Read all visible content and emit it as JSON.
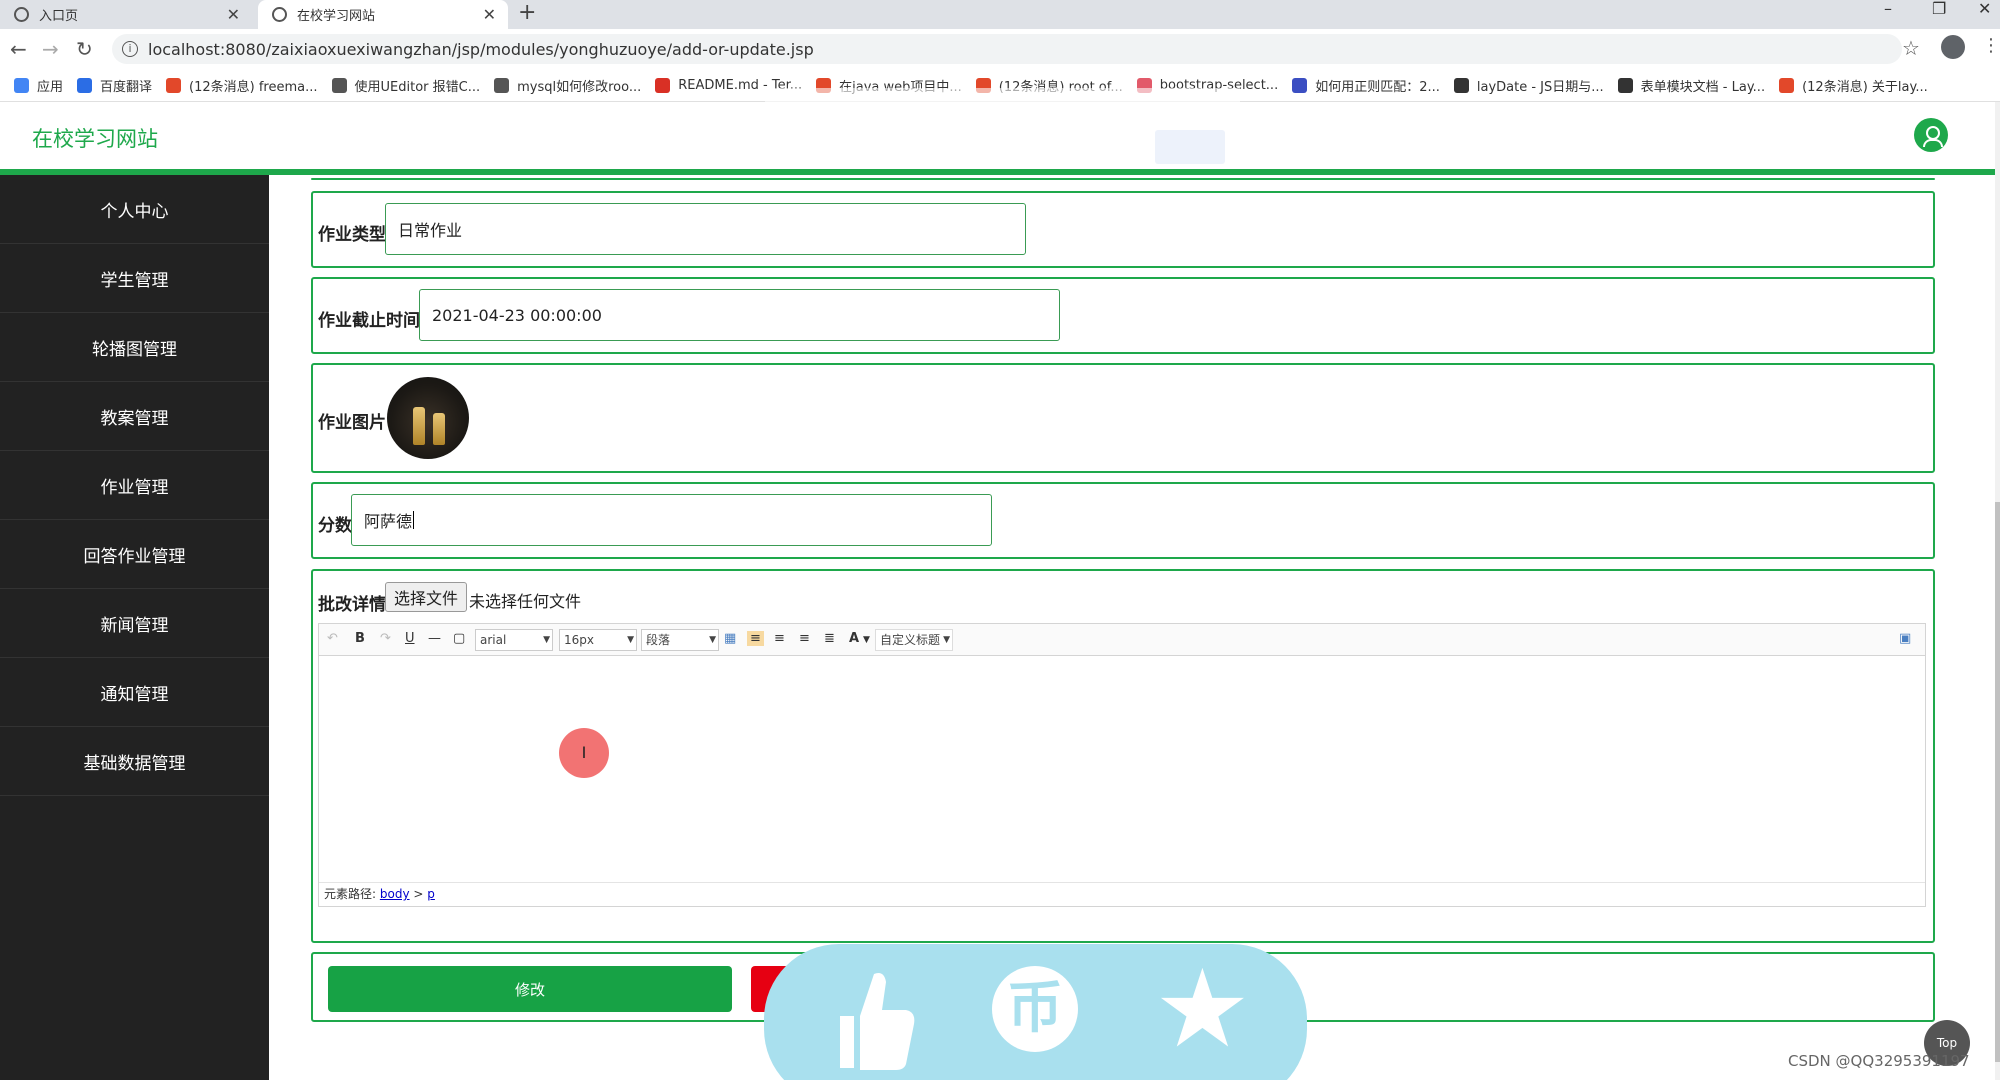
{
  "browser": {
    "tabs": [
      {
        "title": "入口页",
        "active": false
      },
      {
        "title": "在校学习网站",
        "active": true
      }
    ],
    "url": "localhost:8080/zaixiaoxuexiwangzhan/jsp/modules/yonghuzuoye/add-or-update.jsp",
    "bookmarks": [
      {
        "label": "应用",
        "color": "#4285f4"
      },
      {
        "label": "百度翻译",
        "color": "#2b6de5"
      },
      {
        "label": "(12条消息) freema...",
        "color": "#e2482a"
      },
      {
        "label": "使用UEditor 报错C...",
        "color": "#555555"
      },
      {
        "label": "mysql如何修改roo...",
        "color": "#555555"
      },
      {
        "label": "README.md - Ter...",
        "color": "#d93025"
      },
      {
        "label": "在java web项目中...",
        "color": "#e2482a"
      },
      {
        "label": "(12条消息) root of...",
        "color": "#e2482a"
      },
      {
        "label": "bootstrap-select...",
        "color": "#e25a6a"
      },
      {
        "label": "如何用正则匹配：2...",
        "color": "#3b4ec2"
      },
      {
        "label": "layDate - JS日期与...",
        "color": "#333333"
      },
      {
        "label": "表单模块文档 - Lay...",
        "color": "#333333"
      },
      {
        "label": "(12条消息) 关于lay...",
        "color": "#e2482a"
      }
    ]
  },
  "app": {
    "brand": "在校学习网站",
    "accent": "#1ea84b"
  },
  "sidebar": {
    "items": [
      {
        "label": "个人中心"
      },
      {
        "label": "学生管理"
      },
      {
        "label": "轮播图管理"
      },
      {
        "label": "教案管理"
      },
      {
        "label": "作业管理"
      },
      {
        "label": "回答作业管理"
      },
      {
        "label": "新闻管理"
      },
      {
        "label": "通知管理"
      },
      {
        "label": "基础数据管理"
      }
    ]
  },
  "form": {
    "type_label": "作业类型",
    "type_value": "日常作业",
    "deadline_label": "作业截止时间",
    "deadline_value": "2021-04-23 00:00:00",
    "image_label": "作业图片",
    "score_label": "分数",
    "score_value": "阿萨德",
    "detail_label": "批改详情",
    "file_button": "选择文件",
    "file_status": "未选择任何文件",
    "editor": {
      "font": "arial",
      "size": "16px",
      "paragraph": "段落",
      "custom_title": "自定义标题",
      "path_label": "元素路径:",
      "path_body": "body",
      "path_sep": ">",
      "path_p": "p"
    },
    "submit_label": "修改"
  },
  "overlay": {
    "top_label": "Top",
    "watermark": "CSDN @QQ3295391197",
    "coin_glyph": "币",
    "cursor_glyph": "I"
  }
}
